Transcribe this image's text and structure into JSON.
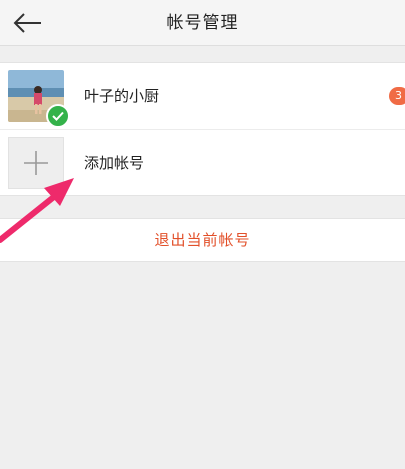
{
  "header": {
    "title": "帐号管理",
    "back_icon": "back-arrow-icon"
  },
  "accounts": [
    {
      "name": "叶子的小厨",
      "badge_count": "3",
      "selected": true
    }
  ],
  "add_account": {
    "label": "添加帐号",
    "icon": "plus-icon"
  },
  "logout": {
    "label": "退出当前帐号"
  },
  "colors": {
    "accent_red": "#e2502a",
    "badge_orange": "#f06b45",
    "check_green": "#34b24a",
    "annotation_pink": "#ee2a6b"
  }
}
